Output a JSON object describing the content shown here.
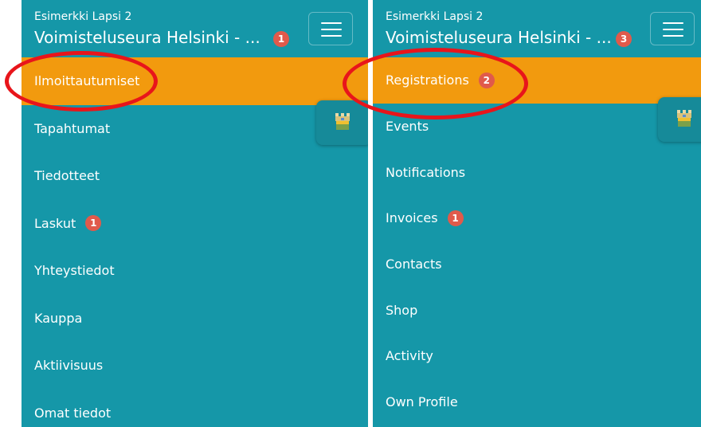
{
  "left": {
    "subtitle": "Esimerkki Lapsi 2",
    "title": "Voimisteluseura Helsinki - ...",
    "title_badge": "1",
    "menu": [
      {
        "label": "Ilmoittautumiset",
        "badge": ""
      },
      {
        "label": "Tapahtumat",
        "badge": ""
      },
      {
        "label": "Tiedotteet",
        "badge": ""
      },
      {
        "label": "Laskut",
        "badge": "1"
      },
      {
        "label": "Yhteystiedot",
        "badge": ""
      },
      {
        "label": "Kauppa",
        "badge": ""
      },
      {
        "label": "Aktiivisuus",
        "badge": ""
      },
      {
        "label": "Omat tiedot",
        "badge": ""
      }
    ]
  },
  "right": {
    "subtitle": "Esimerkki Lapsi 2",
    "title": "Voimisteluseura Helsinki - ...",
    "title_badge": "3",
    "menu": [
      {
        "label": "Registrations",
        "badge": "2"
      },
      {
        "label": "Events",
        "badge": ""
      },
      {
        "label": "Notifications",
        "badge": ""
      },
      {
        "label": "Invoices",
        "badge": "1"
      },
      {
        "label": "Contacts",
        "badge": ""
      },
      {
        "label": "Shop",
        "badge": ""
      },
      {
        "label": "Activity",
        "badge": ""
      },
      {
        "label": "Own Profile",
        "badge": ""
      }
    ]
  },
  "colors": {
    "panel": "#1597a8",
    "active_item": "#f29a0e",
    "badge": "#e05a4b",
    "annotation": "#e8151b"
  },
  "icons": {
    "menu_toggle": "hamburger-icon",
    "floating_button": "castle-icon"
  }
}
